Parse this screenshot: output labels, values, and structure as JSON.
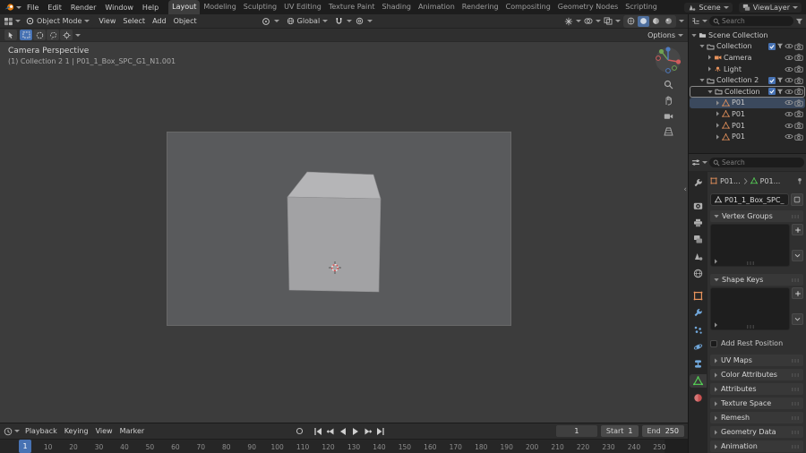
{
  "colors": {
    "accent": "#4772b3",
    "object_orange": "#e8935c",
    "mesh_green": "#56d356"
  },
  "topbar": {
    "menus": [
      "File",
      "Edit",
      "Render",
      "Window",
      "Help"
    ],
    "workspaces": [
      "Layout",
      "Modeling",
      "Sculpting",
      "UV Editing",
      "Texture Paint",
      "Shading",
      "Animation",
      "Rendering",
      "Compositing",
      "Geometry Nodes",
      "Scripting"
    ],
    "active_workspace": "Layout",
    "scene_name": "Scene",
    "view_layer_name": "ViewLayer"
  },
  "viewport_header": {
    "mode": "Object Mode",
    "menus": [
      "View",
      "Select",
      "Add",
      "Object"
    ],
    "orientation": "Global",
    "options": "Options"
  },
  "viewport": {
    "view_label": "Camera Perspective",
    "context_label": "(1) Collection 2 1 | P01_1_Box_SPC_G1_N1.001"
  },
  "outliner": {
    "search_placeholder": "Search",
    "rows": [
      {
        "label": "Scene Collection",
        "icon": "scene-collection",
        "depth": 0,
        "expander": "down",
        "right": []
      },
      {
        "label": "Collection",
        "icon": "collection",
        "depth": 1,
        "expander": "down",
        "checkbox": true,
        "right": [
          "filter",
          "eye",
          "camera"
        ]
      },
      {
        "label": "Camera",
        "icon": "camera-object",
        "depth": 2,
        "expander": "right",
        "right": [
          "eye",
          "camera"
        ]
      },
      {
        "label": "Light",
        "icon": "light-object",
        "depth": 2,
        "expander": "right",
        "right": [
          "eye",
          "camera"
        ]
      },
      {
        "label": "Collection 2",
        "icon": "collection",
        "depth": 1,
        "expander": "down",
        "checkbox": true,
        "right": [
          "filter",
          "eye",
          "camera"
        ]
      },
      {
        "label": "Collection",
        "icon": "collection",
        "depth": 2,
        "expander": "down",
        "checkbox": true,
        "active": true,
        "right": [
          "filter",
          "eye",
          "camera"
        ]
      },
      {
        "label": "P01",
        "icon": "mesh-object",
        "depth": 3,
        "expander": "right",
        "selected": true,
        "right": [
          "eye",
          "camera"
        ]
      },
      {
        "label": "P01",
        "icon": "mesh-object",
        "depth": 3,
        "expander": "right",
        "right": [
          "eye",
          "camera"
        ]
      },
      {
        "label": "P01",
        "icon": "mesh-object",
        "depth": 3,
        "expander": "right",
        "right": [
          "eye",
          "camera"
        ]
      },
      {
        "label": "P01",
        "icon": "mesh-object",
        "depth": 3,
        "expander": "right",
        "right": [
          "eye",
          "camera"
        ]
      }
    ]
  },
  "properties": {
    "search_placeholder": "Search",
    "breadcrumb": [
      {
        "icon": "object",
        "label": "P01..."
      },
      {
        "icon": "mesh",
        "label": "P01..."
      }
    ],
    "datablock_name": "P01_1_Box_SPC_...",
    "tabs": [
      {
        "id": "tool"
      },
      {
        "id": "render"
      },
      {
        "id": "output"
      },
      {
        "id": "view-layer"
      },
      {
        "id": "scene"
      },
      {
        "id": "world"
      },
      {
        "id": "object"
      },
      {
        "id": "modifiers"
      },
      {
        "id": "particles"
      },
      {
        "id": "physics"
      },
      {
        "id": "constraints"
      },
      {
        "id": "object-data"
      },
      {
        "id": "material"
      }
    ],
    "active_tab": "object-data",
    "open_panels": [
      "Vertex Groups",
      "Shape Keys"
    ],
    "rest_position_label": "Add Rest Position",
    "collapsed_panels": [
      "UV Maps",
      "Color Attributes",
      "Attributes",
      "Texture Space",
      "Remesh",
      "Geometry Data",
      "Animation"
    ]
  },
  "timeline": {
    "menus": [
      "Playback",
      "Keying",
      "View",
      "Marker"
    ],
    "current_frame": 1,
    "start_label": "Start",
    "start_value": 1,
    "end_label": "End",
    "end_value": 250,
    "ticks": [
      1,
      10,
      20,
      30,
      40,
      50,
      60,
      70,
      80,
      90,
      100,
      110,
      120,
      130,
      140,
      150,
      160,
      170,
      180,
      190,
      200,
      210,
      220,
      230,
      240,
      250
    ]
  }
}
